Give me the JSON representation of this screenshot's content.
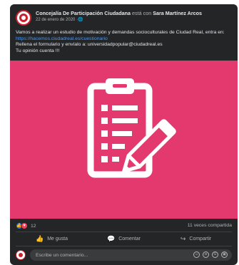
{
  "post": {
    "page_name": "Concejalía De Participación Ciudadana",
    "with_text": "está con",
    "tagged_person": "Sara Martínez Arcos",
    "date": "22 de enero de 2020",
    "audience_icon": "globe-icon",
    "audience_glyph": "·🌐",
    "text_line1": "Vamos a realizar un estudio de motivación y demandas socioculturales de Ciudad Real, entra en:",
    "link": "https://hacemos.ciudadreal.es/cuestionario",
    "text_line2": "Rellena el formulario y envíalo a: universidadpopular@ciudadreal.es",
    "text_line3": "Tu opinión cuenta !!!",
    "image_icon": "clipboard-pencil-icon",
    "image_bg": "#e4396f"
  },
  "stats": {
    "reaction_count": "12",
    "shares": "11 veces compartida",
    "like_glyph": "👍",
    "love_glyph": "♥"
  },
  "actions": {
    "like_label": "Me gusta",
    "like_glyph": "👍",
    "comment_label": "Comentar",
    "comment_glyph": "💬",
    "share_label": "Compartir",
    "share_glyph": "↪"
  },
  "comment": {
    "placeholder": "Escribe un comentario...",
    "emoji_glyph": "☺",
    "camera_glyph": "◘",
    "gif_glyph": "G",
    "sticker_glyph": "▣"
  }
}
